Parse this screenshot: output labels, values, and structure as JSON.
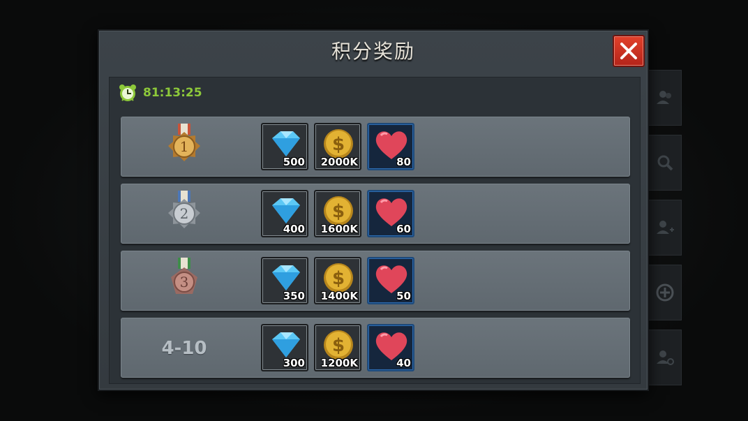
{
  "dialog": {
    "title": "积分奖励"
  },
  "timer": {
    "value": "81:13:25"
  },
  "rewards": [
    {
      "rank": "1",
      "items": [
        {
          "icon": "diamond-icon",
          "qty": "500"
        },
        {
          "icon": "gold-coin-icon",
          "qty": "2000K"
        },
        {
          "icon": "heart-icon",
          "qty": "80"
        }
      ]
    },
    {
      "rank": "2",
      "items": [
        {
          "icon": "diamond-icon",
          "qty": "400"
        },
        {
          "icon": "gold-coin-icon",
          "qty": "1600K"
        },
        {
          "icon": "heart-icon",
          "qty": "60"
        }
      ]
    },
    {
      "rank": "3",
      "items": [
        {
          "icon": "diamond-icon",
          "qty": "350"
        },
        {
          "icon": "gold-coin-icon",
          "qty": "1400K"
        },
        {
          "icon": "heart-icon",
          "qty": "50"
        }
      ]
    },
    {
      "rank": "4-10",
      "items": [
        {
          "icon": "diamond-icon",
          "qty": "300"
        },
        {
          "icon": "gold-coin-icon",
          "qty": "1200K"
        },
        {
          "icon": "heart-icon",
          "qty": "40"
        }
      ]
    }
  ],
  "colors": {
    "medal_gold": "#d9a441",
    "medal_silver": "#c8cdd2",
    "medal_bronze": "#c48f84",
    "close": "#d23522",
    "timer": "#8dc83a"
  }
}
